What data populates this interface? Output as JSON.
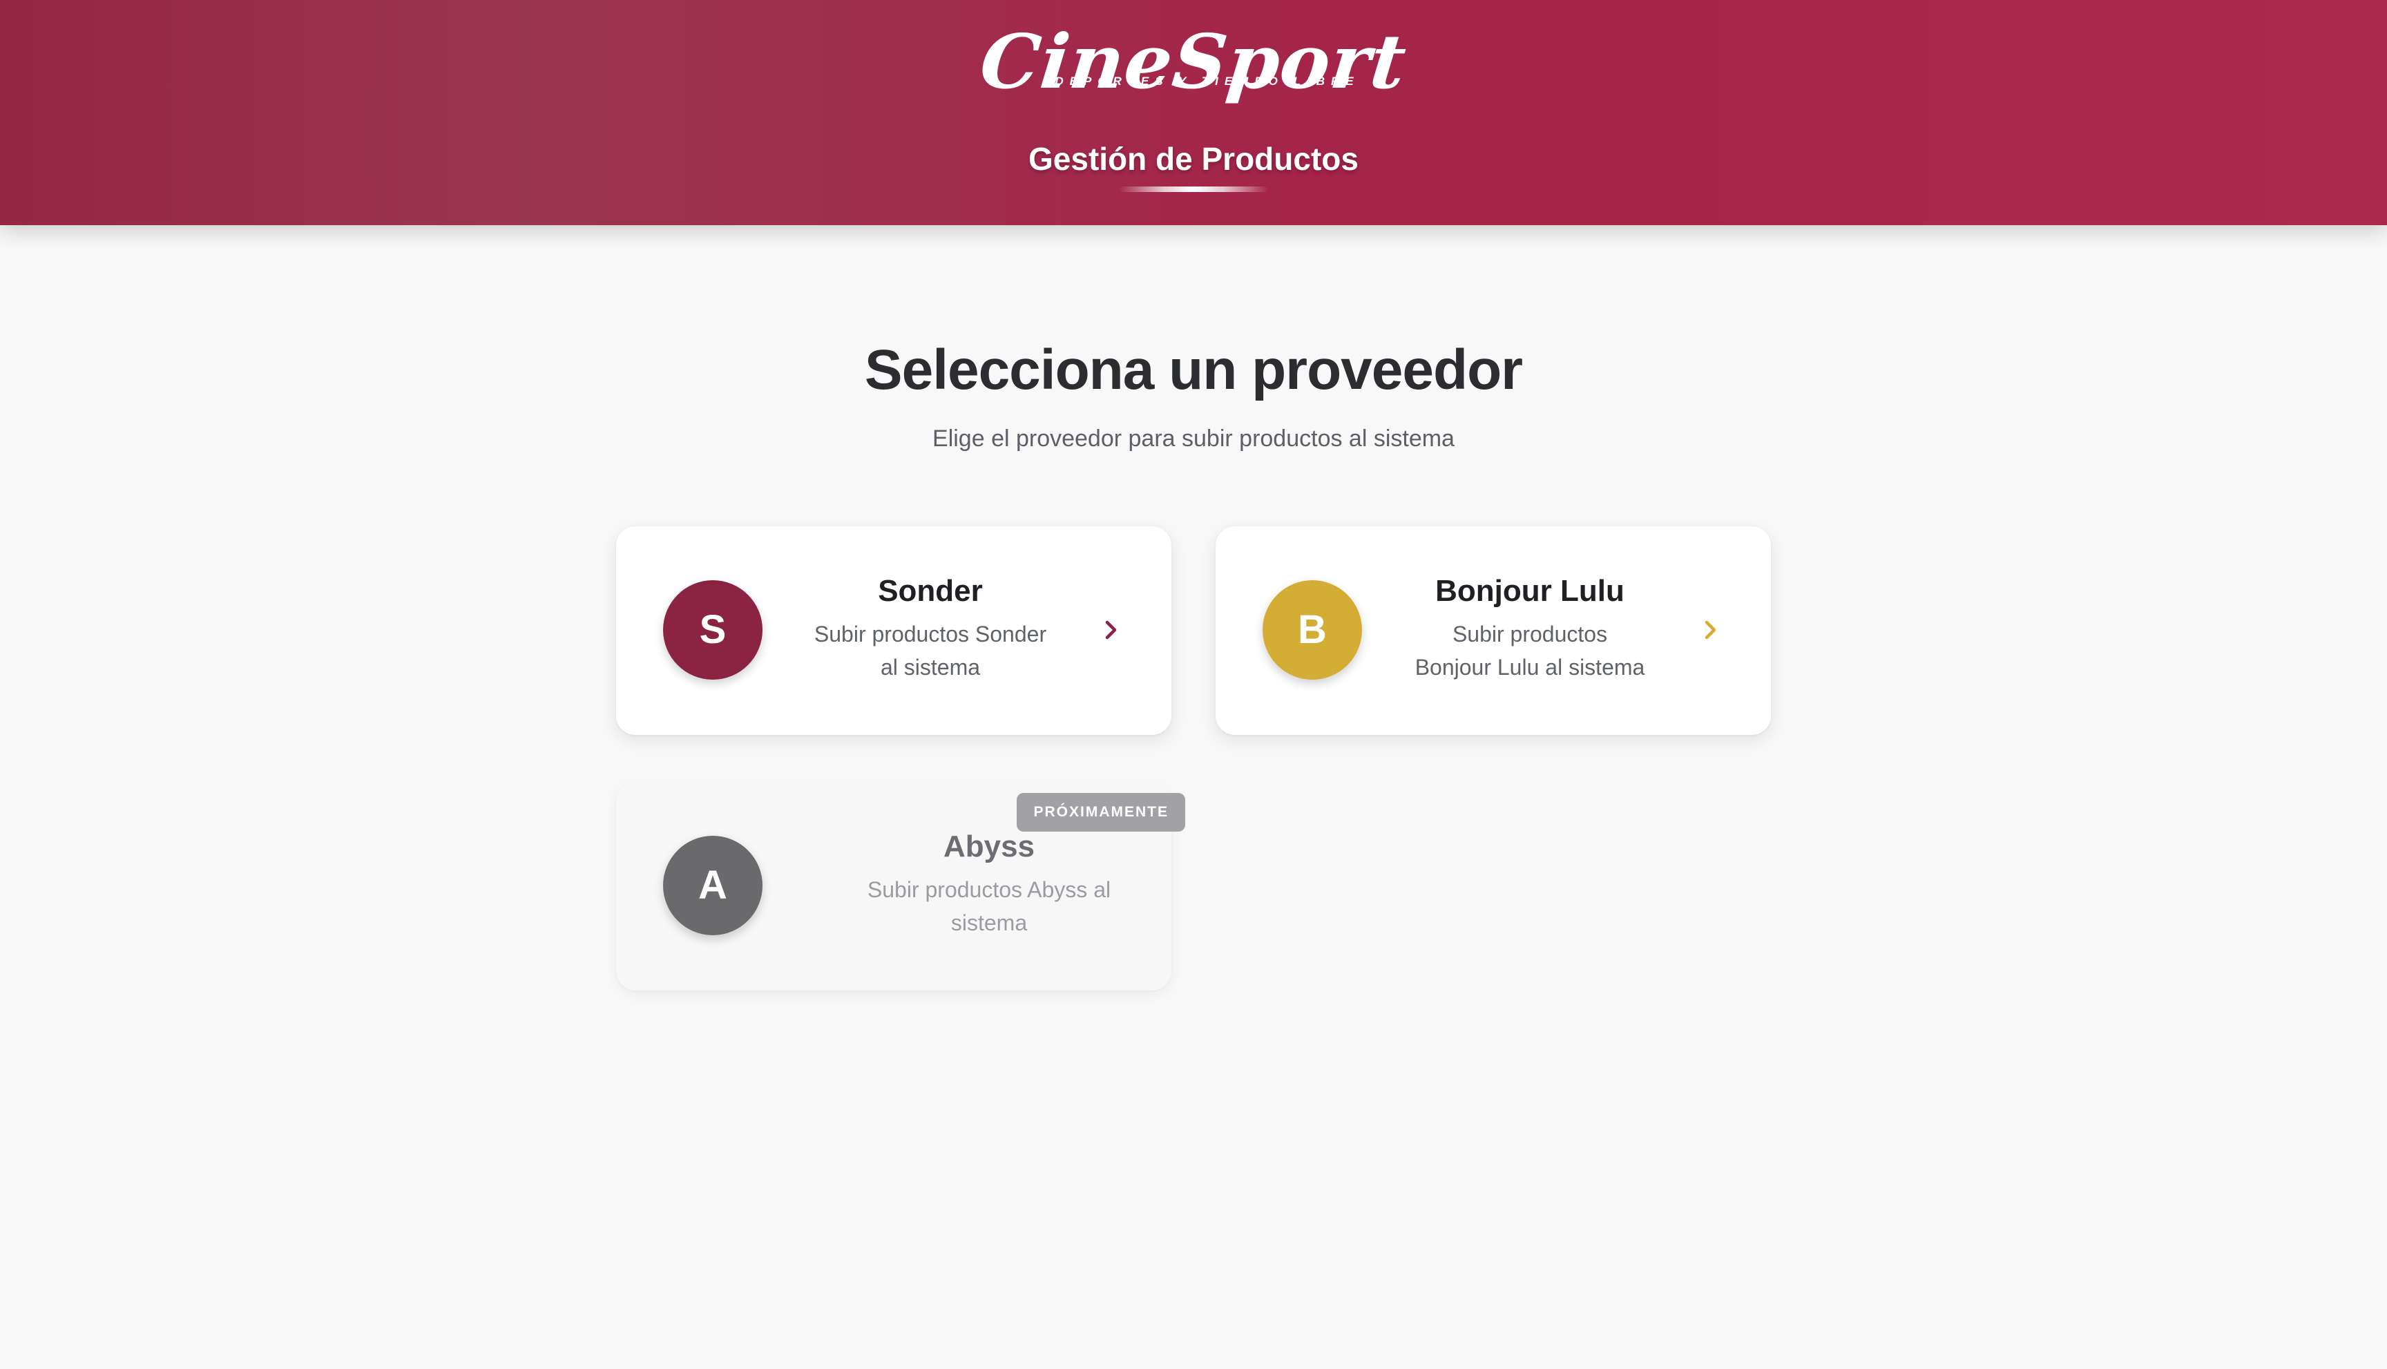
{
  "header": {
    "logo_text": "CineSport",
    "logo_tagline": "DEPORTES Y TIEMPO LIBRE",
    "title": "Gestión de Productos"
  },
  "main": {
    "heading": "Selecciona un proveedor",
    "subheading": "Elige el proveedor para subir productos al sistema"
  },
  "providers": [
    {
      "initial": "S",
      "name": "Sonder",
      "description_line1": "Subir productos Sonder",
      "description_line2": "al sistema",
      "color": "#8b2343",
      "icon": "chevron-right-icon",
      "status": "active"
    },
    {
      "initial": "B",
      "name": "Bonjour Lulu",
      "description_line1": "Subir productos",
      "description_line2": "Bonjour Lulu al sistema",
      "color": "#d4ad35",
      "icon": "chevron-right-icon",
      "status": "active"
    },
    {
      "initial": "A",
      "name": "Abyss",
      "description_line1": "Subir productos Abyss al",
      "description_line2": "sistema",
      "color": "#6a6a6d",
      "badge": "PRÓXIMAMENTE",
      "status": "disabled"
    }
  ],
  "colors": {
    "header_gradient_start": "#952645",
    "header_gradient_end": "#a92a4c",
    "background": "#f8f8f8",
    "badge": "#a2a2a6"
  }
}
